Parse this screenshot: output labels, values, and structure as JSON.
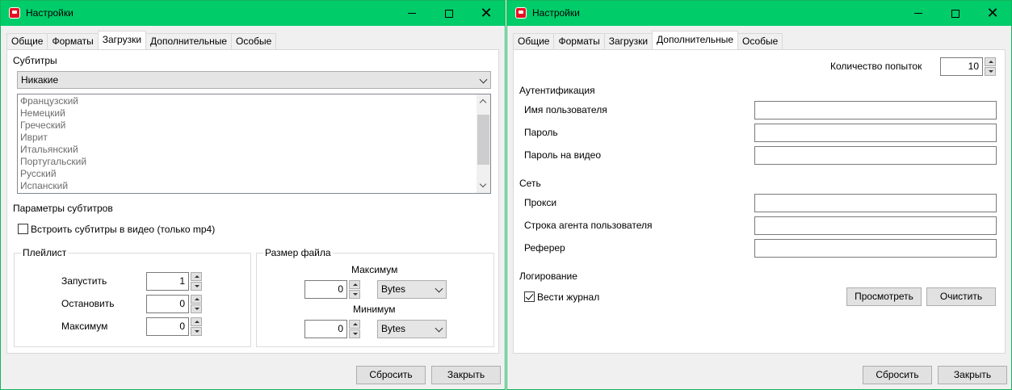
{
  "left_window": {
    "title": "Настройки",
    "tabs": [
      "Общие",
      "Форматы",
      "Загрузки",
      "Дополнительные",
      "Особые"
    ],
    "active_tab": "Загрузки",
    "subtitles": {
      "label": "Субтитры",
      "selected": "Никакие",
      "languages": [
        "Французский",
        "Немецкий",
        "Греческий",
        "Иврит",
        "Итальянский",
        "Португальский",
        "Русский",
        "Испанский"
      ]
    },
    "subtitle_params": {
      "label": "Параметры субтитров",
      "embed_label": "Встроить субтитры в видео (только mp4)",
      "embed_checked": false
    },
    "playlist": {
      "title": "Плейлист",
      "start_label": "Запустить",
      "start_value": "1",
      "stop_label": "Остановить",
      "stop_value": "0",
      "max_label": "Максимум",
      "max_value": "0"
    },
    "filesize": {
      "title": "Размер файла",
      "max_label": "Максимум",
      "max_value": "0",
      "max_unit": "Bytes",
      "min_label": "Минимум",
      "min_value": "0",
      "min_unit": "Bytes"
    },
    "buttons": {
      "reset": "Сбросить",
      "close": "Закрыть"
    }
  },
  "right_window": {
    "title": "Настройки",
    "tabs": [
      "Общие",
      "Форматы",
      "Загрузки",
      "Дополнительные",
      "Особые"
    ],
    "active_tab": "Дополнительные",
    "retries": {
      "label": "Количество попыток",
      "value": "10"
    },
    "auth": {
      "section": "Аутентификация",
      "username_label": "Имя пользователя",
      "username_value": "",
      "password_label": "Пароль",
      "password_value": "",
      "video_password_label": "Пароль на видео",
      "video_password_value": ""
    },
    "network": {
      "section": "Сеть",
      "proxy_label": "Прокси",
      "proxy_value": "",
      "user_agent_label": "Строка агента пользователя",
      "user_agent_value": "",
      "referer_label": "Реферер",
      "referer_value": ""
    },
    "logging": {
      "section": "Логирование",
      "keep_log_label": "Вести журнал",
      "keep_log_checked": true,
      "view_button": "Просмотреть",
      "clear_button": "Очистить"
    },
    "buttons": {
      "reset": "Сбросить",
      "close": "Закрыть"
    }
  },
  "colors": {
    "titlebar": "#00cc6a",
    "window_bg": "#f0f0f0",
    "panel_bg": "#ffffff",
    "app_icon": "#e81123"
  },
  "icons": {
    "app": "app-icon",
    "minimize": "minimize-icon",
    "maximize": "maximize-icon",
    "close": "close-icon",
    "combo_arrow": "chevron-down-icon",
    "checkbox": "checkmark-icon",
    "spin": "spin-arrows-icon"
  }
}
